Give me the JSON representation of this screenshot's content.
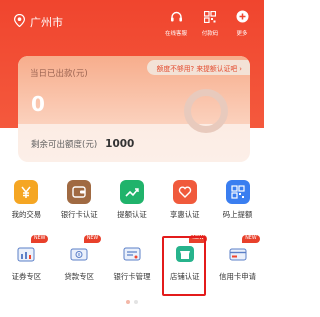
{
  "location": {
    "city": "广州市"
  },
  "top_actions": [
    {
      "label": "在线客服",
      "icon": "headset-icon"
    },
    {
      "label": "付款码",
      "icon": "payment-code-icon"
    },
    {
      "label": "更多",
      "icon": "plus-icon"
    }
  ],
  "card": {
    "today_label": "当日已出款(元)",
    "today_value": "0",
    "promo": "额度不够用? 来提额认证吧 ›",
    "remaining_label": "剩余可出额度(元)",
    "remaining_value": "1000"
  },
  "grid": {
    "row1": [
      {
        "label": "我的交易",
        "icon": "yen-icon",
        "color": "#f5a623"
      },
      {
        "label": "银行卡认证",
        "icon": "wallet-icon",
        "color": "#a06a42"
      },
      {
        "label": "提额认证",
        "icon": "trend-icon",
        "color": "#20b36b"
      },
      {
        "label": "享惠认证",
        "icon": "heart-icon",
        "color": "#f05a3c"
      },
      {
        "label": "码上提额",
        "icon": "qrcode-icon",
        "color": "#3a7ef0"
      }
    ],
    "row2": [
      {
        "label": "证券专区",
        "icon": "securities-icon",
        "badge": "NEW"
      },
      {
        "label": "贷款专区",
        "icon": "loan-icon",
        "badge": "NEW"
      },
      {
        "label": "银行卡管理",
        "icon": "card-manage-icon",
        "badge": ""
      },
      {
        "label": "店铺认证",
        "icon": "store-icon",
        "badge": "NEW"
      },
      {
        "label": "信用卡申请",
        "icon": "credit-card-icon",
        "badge": "NEW"
      }
    ]
  },
  "colors": {
    "header": "#f0452e",
    "accent": "#e8402b"
  }
}
